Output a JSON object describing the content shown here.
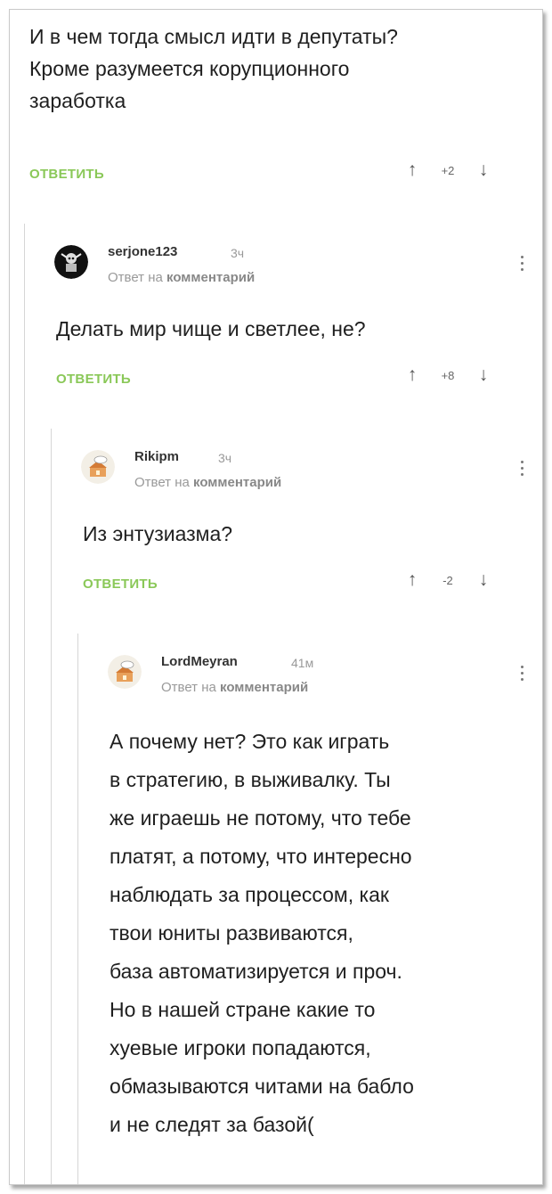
{
  "root_comment": {
    "lines": [
      "И в чем тогда смысл идти в депутаты?",
      "Кроме разумеется корупционного",
      "заработка"
    ],
    "reply_label": "ОТВЕТИТЬ",
    "rating": "+2"
  },
  "reply1": {
    "username": "serjone123",
    "time": "3ч",
    "reply_to_prefix": "Ответ на",
    "reply_to_link": "комментарий",
    "lines": [
      "Делать мир чище и светлее, не?"
    ],
    "reply_label": "ОТВЕТИТЬ",
    "rating": "+8"
  },
  "reply2": {
    "username": "Rikipm",
    "time": "3ч",
    "reply_to_prefix": "Ответ на",
    "reply_to_link": "комментарий",
    "lines": [
      "Из энтузиазма?"
    ],
    "reply_label": "ОТВЕТИТЬ",
    "rating": "-2"
  },
  "reply3": {
    "username": "LordMeyran",
    "time": "41м",
    "reply_to_prefix": "Ответ на",
    "reply_to_link": "комментарий",
    "lines": [
      "А почему нет? Это как играть",
      "в стратегию, в выживалку. Ты",
      "же играешь не потому, что тебе",
      "платят, а потому, что интересно",
      "наблюдать за процессом, как",
      "твои юниты развиваются,",
      "база автоматизируется и проч.",
      "Но в нашей стране какие то",
      "хуевые игроки попадаются,",
      "обмазываются читами на бабло",
      "и не следят за базой("
    ]
  },
  "icons": {
    "upvote": "arrow-up-icon",
    "downvote": "arrow-down-icon",
    "menu": "more-vertical-icon"
  },
  "colors": {
    "reply_green": "#8ac858",
    "thread_line": "#d6d6d6",
    "meta_gray": "#999999"
  }
}
